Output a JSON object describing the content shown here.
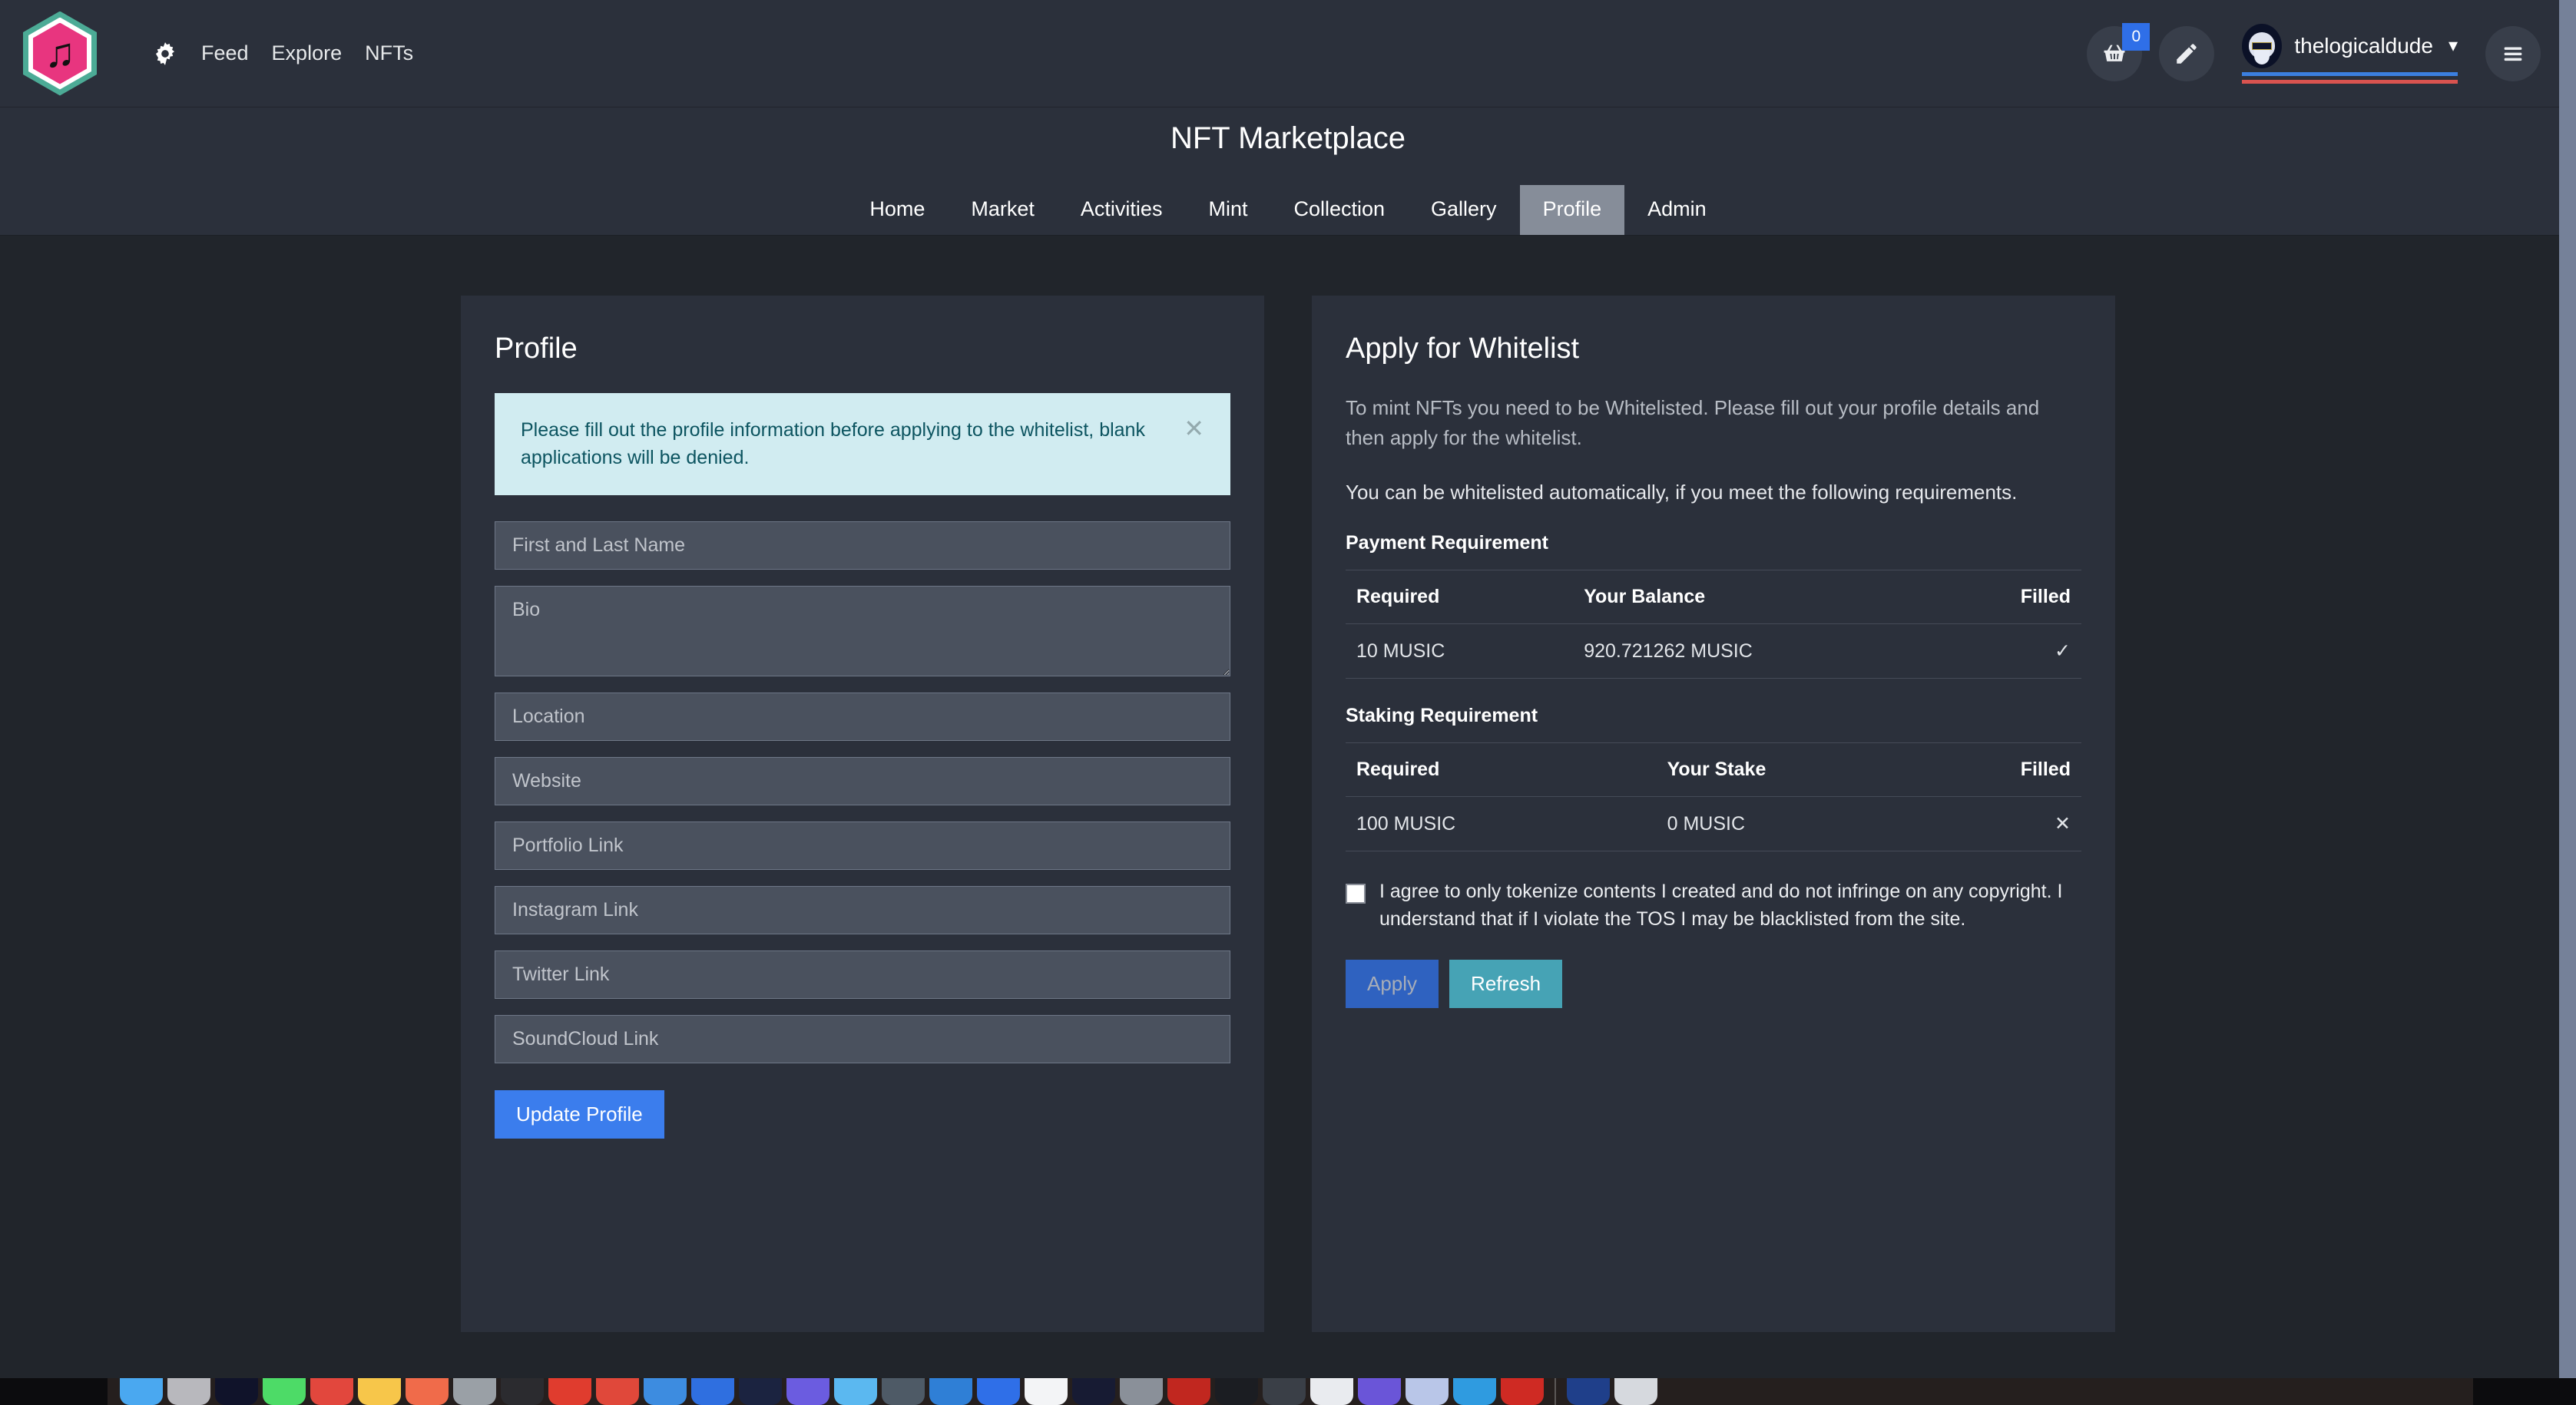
{
  "header": {
    "logo_icon": "music-note-hexagon-logo",
    "gear_icon": "gear-icon",
    "nav_links": [
      "Feed",
      "Explore",
      "NFTs"
    ],
    "cart_icon": "shopping-basket-icon",
    "cart_count": "0",
    "edit_icon": "pencil-icon",
    "avatar_icon": "user-avatar",
    "username": "thelogicaldude",
    "caret_icon": "chevron-down-icon",
    "hamburger_icon": "hamburger-menu-icon"
  },
  "subheader": {
    "title": "NFT Marketplace",
    "tabs": [
      {
        "label": "Home",
        "active": false
      },
      {
        "label": "Market",
        "active": false
      },
      {
        "label": "Activities",
        "active": false
      },
      {
        "label": "Mint",
        "active": false
      },
      {
        "label": "Collection",
        "active": false
      },
      {
        "label": "Gallery",
        "active": false
      },
      {
        "label": "Profile",
        "active": true
      },
      {
        "label": "Admin",
        "active": false
      }
    ]
  },
  "profile_card": {
    "heading": "Profile",
    "alert": {
      "text": "Please fill out the profile information before applying to the whitelist, blank applications will be denied.",
      "close_label": "✕",
      "bg_color": "#d1ecf1",
      "text_color": "#0c5460"
    },
    "fields": [
      {
        "name": "name",
        "placeholder": "First and Last Name",
        "value": "",
        "type": "input"
      },
      {
        "name": "bio",
        "placeholder": "Bio",
        "value": "",
        "type": "textarea"
      },
      {
        "name": "location",
        "placeholder": "Location",
        "value": "",
        "type": "input"
      },
      {
        "name": "website",
        "placeholder": "Website",
        "value": "",
        "type": "input"
      },
      {
        "name": "portfolio",
        "placeholder": "Portfolio Link",
        "value": "",
        "type": "input"
      },
      {
        "name": "instagram",
        "placeholder": "Instagram Link",
        "value": "",
        "type": "input"
      },
      {
        "name": "twitter",
        "placeholder": "Twitter Link",
        "value": "",
        "type": "input"
      },
      {
        "name": "soundcloud",
        "placeholder": "SoundCloud Link",
        "value": "",
        "type": "input"
      }
    ],
    "update_button": "Update Profile",
    "update_button_color": "#3b7ded"
  },
  "whitelist_card": {
    "heading": "Apply for Whitelist",
    "intro": "To mint NFTs you need to be Whitelisted. Please fill out your profile details and then apply for the whitelist.",
    "auto_note": "You can be whitelisted automatically, if you meet the following requirements.",
    "payment": {
      "subhead": "Payment Requirement",
      "columns": [
        "Required",
        "Your Balance",
        "Filled"
      ],
      "rows": [
        {
          "required": "10 MUSIC",
          "yours": "920.721262 MUSIC",
          "filled": "✓",
          "filled_state": "ok"
        }
      ]
    },
    "staking": {
      "subhead": "Staking Requirement",
      "columns": [
        "Required",
        "Your Stake",
        "Filled"
      ],
      "rows": [
        {
          "required": "100 MUSIC",
          "yours": "0 MUSIC",
          "filled": "✕",
          "filled_state": "bad"
        }
      ]
    },
    "agreement": {
      "checked": false,
      "text": "I agree to only tokenize contents I created and do not infringe on any copyright. I understand that if I violate the TOS I may be blacklisted from the site."
    },
    "apply_button": "Apply",
    "apply_enabled": false,
    "apply_color": "#2f62c0",
    "refresh_button": "Refresh",
    "refresh_color": "#46a3b5"
  },
  "colors": {
    "page_bg": "#21252b",
    "card_bg": "#2b303b",
    "header_bg": "#2b303b",
    "field_bg": "#4a515e",
    "accent_blue": "#3b7ded",
    "accent_teal": "#46a3b5",
    "ok_green": "#3fbf4b",
    "bad_red": "#d9534f",
    "logo_pink": "#e8357f",
    "logo_teal": "#4cab96",
    "scrollbar": "#758199"
  },
  "dock": {
    "icons": [
      "#4aa8f0",
      "#b8b8bd",
      "#10132a",
      "#4ddb67",
      "#e2473d",
      "#f7c64a",
      "#f06b4a",
      "#9aa0a6",
      "#2b2b2f",
      "#e03c2e",
      "#e0483a",
      "#3d8ce0",
      "#2f6fe0",
      "#1b2340",
      "#6b5ce0",
      "#5bb8f0",
      "#4e5a66",
      "#2f7fd6",
      "#2f6fe8",
      "#f3f4f6",
      "#171b33",
      "#8a9099",
      "#c1271f",
      "#1b1d22",
      "#3a3f47",
      "#e9ebef",
      "#6a55d8",
      "#b9c6e8",
      "#2f9be0",
      "#cf2a23",
      "#1f3f8a",
      "#d6d9de"
    ],
    "separator_after": [
      29
    ]
  }
}
